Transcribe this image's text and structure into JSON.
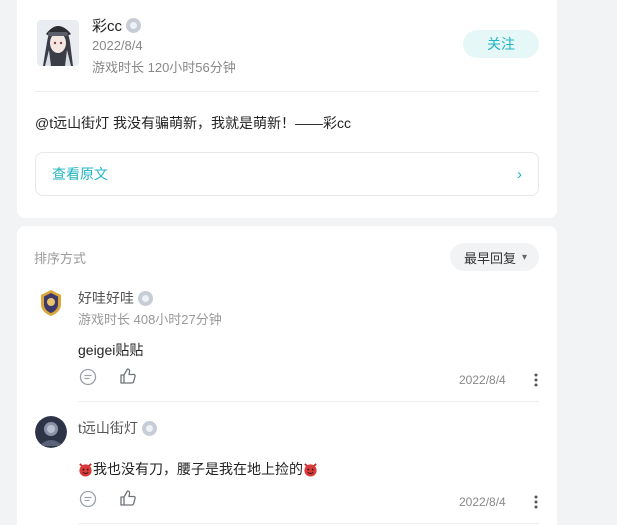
{
  "post": {
    "author_name": "彩cc",
    "date": "2022/8/4",
    "playtime": "游戏时长 120小时56分钟",
    "follow_label": "关注",
    "content": "@t远山街灯 我没有骗萌新，我就是萌新！——彩cc",
    "view_original_label": "查看原文",
    "chevron": "›"
  },
  "replies_header": {
    "sort_label": "排序方式",
    "sort_value": "最早回复",
    "sort_arrow": "▾"
  },
  "replies": [
    {
      "name": "好哇好哇",
      "playtime": "游戏时长 408小时27分钟",
      "text": "geigei贴贴",
      "date": "2022/8/4"
    },
    {
      "name": "t远山街灯",
      "playtime": "",
      "text": "我也没有刀，腰子是我在地上捡的",
      "date": "2022/8/4"
    }
  ],
  "colors": {
    "accent": "#1fb5c1",
    "background": "#f2f3f5"
  },
  "icons": [
    "badge-icon",
    "chevron-right-icon",
    "chevron-down-icon",
    "comment-icon",
    "like-icon",
    "more-icon",
    "devil-emoji-icon"
  ]
}
